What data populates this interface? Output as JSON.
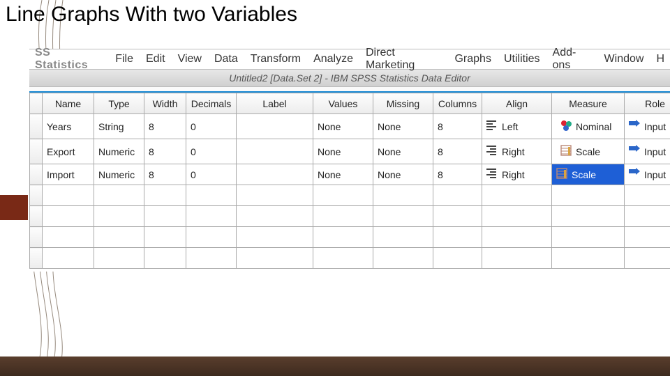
{
  "slide": {
    "title": "Line Graphs With two Variables"
  },
  "app": {
    "truncated_brand": "SS Statistics",
    "menu": [
      "File",
      "Edit",
      "View",
      "Data",
      "Transform",
      "Analyze",
      "Direct Marketing",
      "Graphs",
      "Utilities",
      "Add-ons",
      "Window",
      "H"
    ],
    "window_title": "Untitled2 [Data.Set 2] - IBM SPSS Statistics Data Editor"
  },
  "table": {
    "headers": [
      "Name",
      "Type",
      "Width",
      "Decimals",
      "Label",
      "Values",
      "Missing",
      "Columns",
      "Align",
      "Measure",
      "Role"
    ],
    "rows": [
      {
        "name": "Years",
        "type": "String",
        "width": "8",
        "decimals": "0",
        "label": "",
        "values": "None",
        "missing": "None",
        "columns": "8",
        "align": "Left",
        "measure": "Nominal",
        "role": "Input",
        "align_icon": "left",
        "measure_icon": "nominal",
        "selected": false
      },
      {
        "name": "Export",
        "type": "Numeric",
        "width": "8",
        "decimals": "0",
        "label": "",
        "values": "None",
        "missing": "None",
        "columns": "8",
        "align": "Right",
        "measure": "Scale",
        "role": "Input",
        "align_icon": "right",
        "measure_icon": "scale",
        "selected": false
      },
      {
        "name": "Import",
        "type": "Numeric",
        "width": "8",
        "decimals": "0",
        "label": "",
        "values": "None",
        "missing": "None",
        "columns": "8",
        "align": "Right",
        "measure": "Scale",
        "role": "Input",
        "align_icon": "right",
        "measure_icon": "scale",
        "selected": true
      }
    ],
    "empty_rows": 4
  }
}
